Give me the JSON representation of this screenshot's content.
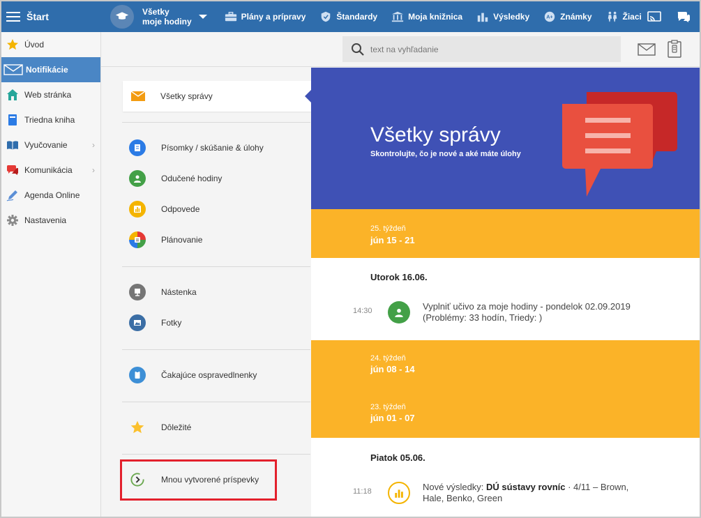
{
  "topbar": {
    "start_label": "Štart",
    "class_line1": "Všetky",
    "class_line2": "moje hodiny",
    "nav": [
      {
        "label": "Plány a prípravy",
        "icon": "briefcase-icon"
      },
      {
        "label": "Štandardy",
        "icon": "shield-icon"
      },
      {
        "label": "Moja knižnica",
        "icon": "library-icon"
      },
      {
        "label": "Výsledky",
        "icon": "bar-chart-icon"
      },
      {
        "label": "Známky",
        "icon": "grades-icon"
      },
      {
        "label": "Žiaci",
        "icon": "students-icon"
      }
    ]
  },
  "sidebar": {
    "items": [
      {
        "label": "Úvod",
        "icon": "star-icon"
      },
      {
        "label": "Notifikácie",
        "icon": "envelope-icon",
        "active": true
      },
      {
        "label": "Web stránka",
        "icon": "home-icon"
      },
      {
        "label": "Triedna kniha",
        "icon": "book-icon"
      },
      {
        "label": "Vyučovanie",
        "icon": "open-book-icon",
        "chevron": "›"
      },
      {
        "label": "Komunikácia",
        "icon": "chat-icon",
        "chevron": "›"
      },
      {
        "label": "Agenda Online",
        "icon": "pen-icon"
      },
      {
        "label": "Nastavenia",
        "icon": "gear-icon"
      }
    ]
  },
  "search": {
    "placeholder": "text na vyhľadanie"
  },
  "filters": {
    "selected": "Všetky správy",
    "items": [
      {
        "label": "Písomky / skúšanie & úlohy",
        "color": "#2b7be5"
      },
      {
        "label": "Odučené hodiny",
        "color": "#43a047"
      },
      {
        "label": "Odpovede",
        "color": "#f4b400"
      },
      {
        "label": "Plánovanie",
        "color": "#e53935"
      },
      {
        "label": "Nástenka",
        "color": "#757575"
      },
      {
        "label": "Fotky",
        "color": "#3b6ea5"
      },
      {
        "label": "Čakajúce ospravedlnenky",
        "color": "#3d8fd6"
      },
      {
        "label": "Dôležité",
        "color": "#fbc02d"
      },
      {
        "label": "Mnou vytvorené príspevky",
        "color": "#6aa84f"
      }
    ]
  },
  "hero": {
    "title": "Všetky správy",
    "subtitle": "Skontrolujte, čo je nové a aké máte úlohy"
  },
  "feed": {
    "week1": {
      "label": "25. týždeň",
      "range": "jún 15 - 21"
    },
    "day1": "Utorok 16.06.",
    "entry1": {
      "time": "14:30",
      "line1": "Vyplniť učivo za moje hodiny - pondelok 02.09.2019",
      "line2": "(Problémy: 33 hodín, Triedy: )"
    },
    "week2": {
      "label": "24. týždeň",
      "range": "jún 08 - 14"
    },
    "week3": {
      "label": "23. týždeň",
      "range": "jún 01 - 07"
    },
    "day2": "Piatok 05.06.",
    "entry2": {
      "time": "11:18",
      "prefix": "Nové výsledky: ",
      "bold": "DÚ sústavy rovníc",
      "suffix": " · 4/11 – Brown,",
      "line2": "Hale, Benko, Green"
    }
  },
  "colors": {
    "topbar": "#2f6dac",
    "hero": "#3f51b5",
    "week": "#fbb328",
    "highlight": "#e3202c"
  }
}
